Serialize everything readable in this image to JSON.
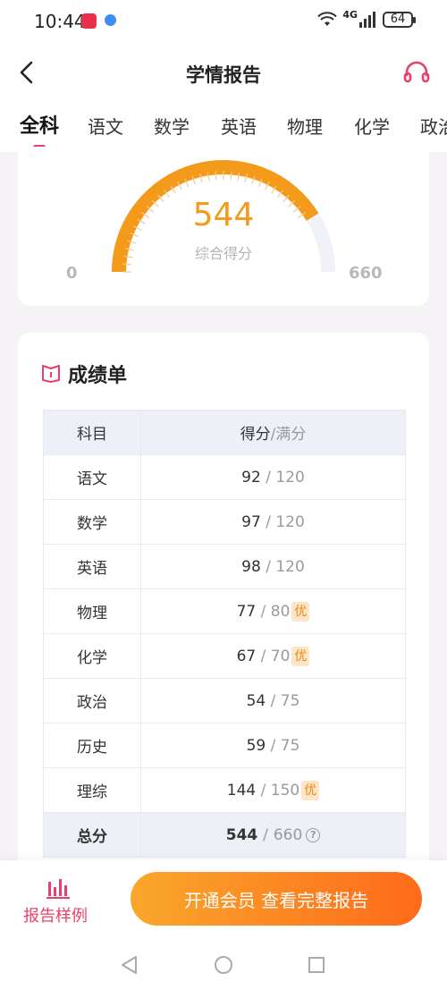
{
  "status_bar": {
    "time": "10:44",
    "network": "4G",
    "battery": "64"
  },
  "header": {
    "title": "学情报告"
  },
  "tabs": [
    "全科",
    "语文",
    "数学",
    "英语",
    "物理",
    "化学",
    "政治"
  ],
  "gauge": {
    "score": "544",
    "label": "综合得分",
    "min": "0",
    "max": "660",
    "value": 544,
    "max_value": 660
  },
  "report": {
    "title": "成绩单",
    "header_subject": "科目",
    "header_score": "得分",
    "header_full": "/满分",
    "rows": [
      {
        "subject": "语文",
        "score": "92",
        "full": "120",
        "badge": ""
      },
      {
        "subject": "数学",
        "score": "97",
        "full": "120",
        "badge": ""
      },
      {
        "subject": "英语",
        "score": "98",
        "full": "120",
        "badge": ""
      },
      {
        "subject": "物理",
        "score": "77",
        "full": "80",
        "badge": "优"
      },
      {
        "subject": "化学",
        "score": "67",
        "full": "70",
        "badge": "优"
      },
      {
        "subject": "政治",
        "score": "54",
        "full": "75",
        "badge": ""
      },
      {
        "subject": "历史",
        "score": "59",
        "full": "75",
        "badge": ""
      },
      {
        "subject": "理综",
        "score": "144",
        "full": "150",
        "badge": "优"
      }
    ],
    "total": {
      "subject": "总分",
      "score": "544",
      "full": "660",
      "help": "?"
    }
  },
  "bottom": {
    "sample_label": "报告样例",
    "cta_label": "开通会员 查看完整报告"
  },
  "colors": {
    "accent": "#e8406a",
    "gauge_orange": "#f39a1b",
    "cta_start": "#f9a72b",
    "cta_end": "#ff6a1a"
  }
}
